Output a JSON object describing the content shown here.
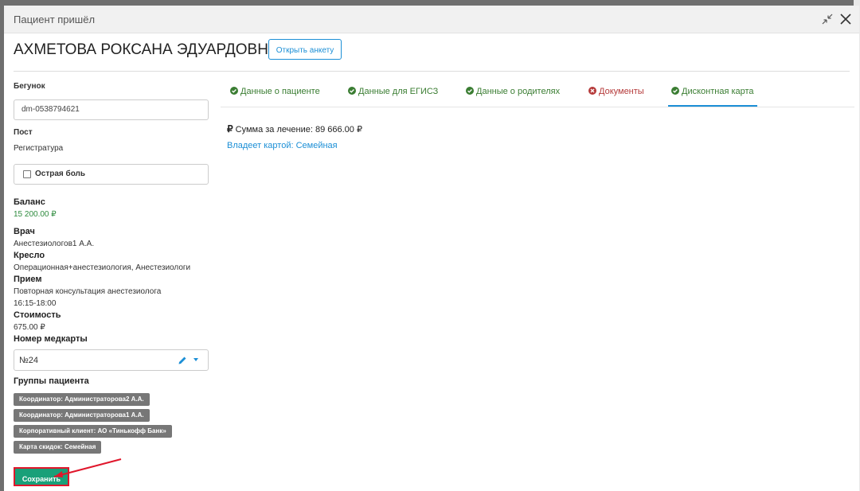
{
  "modal": {
    "title": "Пациент пришёл",
    "collapse_icon": "collapse-icon",
    "close_icon": "close-icon"
  },
  "patient": {
    "name": "АХМЕТОВА РОКСАНА ЭДУАРДОВНА",
    "open_form_label": "Открыть анкету"
  },
  "left": {
    "runner_label": "Бегунок",
    "runner_value": "dm-0538794621",
    "post_label": "Пост",
    "post_value": "Регистратура",
    "acute_pain_label": "Острая боль",
    "balance_label": "Баланс",
    "balance_value": "15 200.00 ₽",
    "doctor_label": "Врач",
    "doctor_value": "Анестезиологов1 А.А.",
    "chair_label": "Кресло",
    "chair_value": "Операционная+анестезиология, Анестезиологи",
    "appointment_label": "Прием",
    "appointment_value": "Повторная консультация анестезиолога",
    "appointment_time": "16:15-18:00",
    "cost_label": "Стоимость",
    "cost_value": "675.00 ₽",
    "card_number_label": "Номер медкарты",
    "card_number_value": "№24",
    "groups_label": "Группы пациента",
    "groups": [
      "Координатор: Администраторова2 А.А.",
      "Координатор: Администраторова1 А.А.",
      "Корпоративный клиент: АО «Тинькофф Банк»",
      "Карта скидок: Семейная"
    ],
    "save_label": "Сохранить"
  },
  "tabs": [
    {
      "label": "Данные о пациенте",
      "status": "ok"
    },
    {
      "label": "Данные для ЕГИСЗ",
      "status": "ok"
    },
    {
      "label": "Данные о родителях",
      "status": "ok"
    },
    {
      "label": "Документы",
      "status": "error"
    },
    {
      "label": "Дисконтная карта",
      "status": "ok",
      "active": true
    }
  ],
  "discount": {
    "sum_label": "Сумма за лечение: 89 666.00 ₽",
    "owns_card": "Владеет картой: Семейная"
  },
  "colors": {
    "accent": "#1c8fd6",
    "save": "#19a079",
    "ok": "#3a7d32",
    "error": "#b53a3a",
    "annotation": "#e0162b"
  }
}
